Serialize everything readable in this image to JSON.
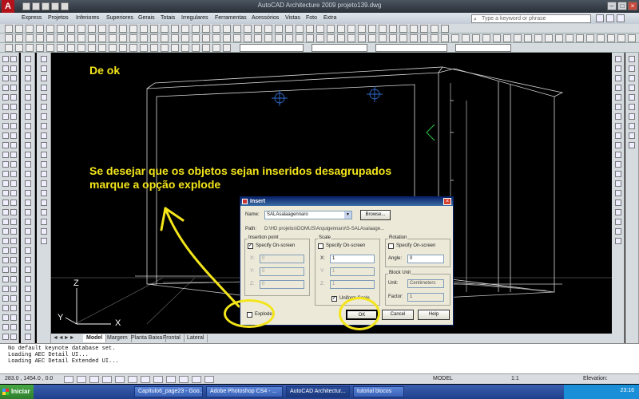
{
  "window": {
    "title": "AutoCAD Architecture 2009  projeto139.dwg"
  },
  "menu": {
    "items": [
      "Express",
      "Projetos",
      "Inferiores",
      "Superiores",
      "Gerais",
      "Totais",
      "Irregulares",
      "Ferramentas",
      "Acessórios",
      "Vistas",
      "Foto",
      "Extra"
    ]
  },
  "search": {
    "placeholder": "Type a keyword or phrase"
  },
  "annotations": {
    "top": "De ok",
    "line1": "Se desejar que os objetos sejan inseridos desagrupados",
    "line2": "marque a opção explode"
  },
  "axes": {
    "z": "Z",
    "y": "Y",
    "x": "X"
  },
  "layout_tabs": [
    "Model",
    "Margem",
    "Planta Baixa",
    "Frontal",
    "Lateral"
  ],
  "dialog": {
    "title": "Insert",
    "name_label": "Name:",
    "name_value": "SALAsalaagennaro",
    "browse_label": "Browse...",
    "path_label": "Path:",
    "path_value": "D:\\HD projetos\\DOMUS\\Arquigennaro\\S-SALAsalaage...",
    "insertion_point": {
      "title": "Insertion point",
      "specify": "Specify On-screen",
      "x": "X:",
      "y": "Y:",
      "z": "Z:",
      "xv": "0",
      "yv": "0",
      "zv": "0"
    },
    "scale": {
      "title": "Scale",
      "specify": "Specify On-screen",
      "x": "X:",
      "y": "Y:",
      "z": "Z:",
      "xv": "1",
      "yv": "1",
      "zv": "1",
      "uniform": "Uniform Scale"
    },
    "rotation": {
      "title": "Rotation",
      "specify": "Specify On-screen",
      "angle_label": "Angle:",
      "angle_value": "0"
    },
    "block_unit": {
      "title": "Block Unit",
      "unit_label": "Unit:",
      "unit_value": "Centimeters",
      "factor_label": "Factor:",
      "factor_value": "1"
    },
    "explode_label": "Explode",
    "ok_label": "OK",
    "cancel_label": "Cancel",
    "help_label": "Help"
  },
  "command_lines": [
    "No default keynote database set.",
    "Loading AEC Detail UI...",
    "Loading AEC Detail Extended UI..."
  ],
  "status": {
    "coords": "283.0 , 1454.0 , 0.0",
    "model": "MODEL",
    "scale": "1:1",
    "elevation": "Elevation:"
  },
  "taskbar": {
    "start": "Iniciar",
    "tasks": [
      "Capítulo6_page23 - Goo...",
      "Adobe Photoshop CS4 - ...",
      "AutoCAD Architectur...",
      "tutorial blocos"
    ],
    "clock": "23:16"
  },
  "colors": {
    "annotation": "#f3e51a",
    "titlebar": "#2a3038",
    "taskbar": "#1f3f8a"
  }
}
